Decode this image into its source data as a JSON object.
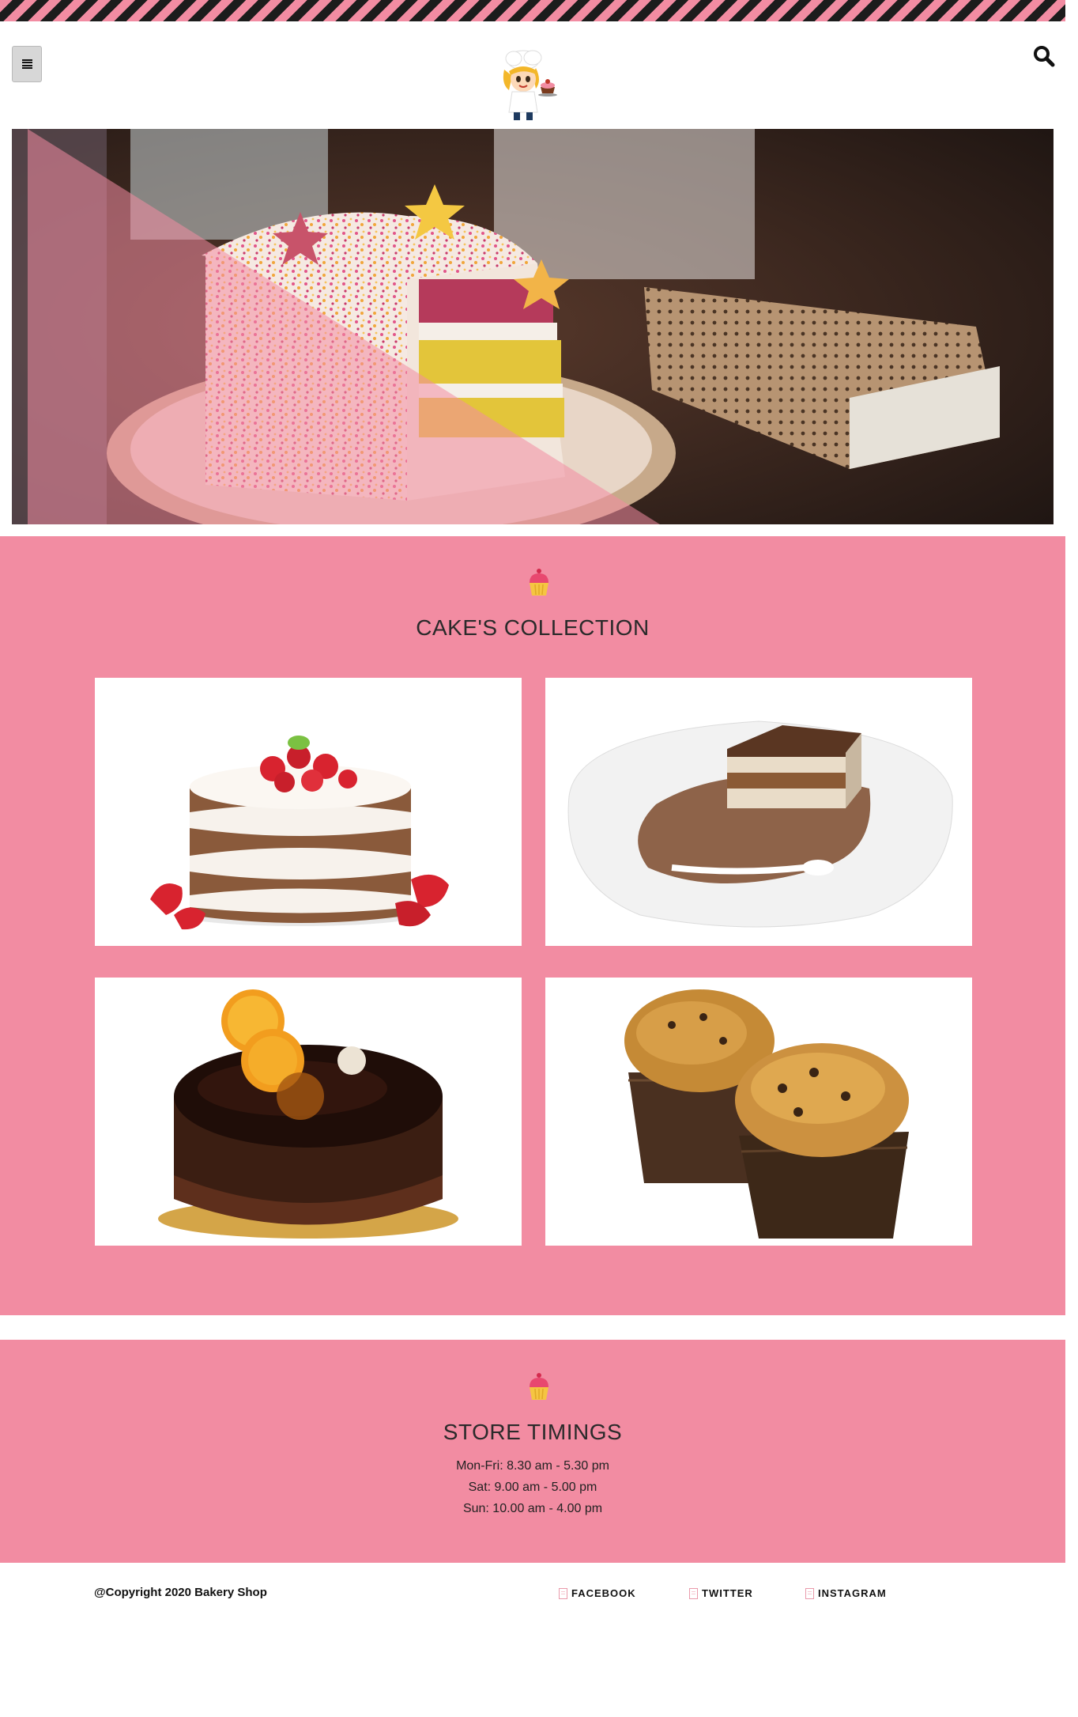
{
  "header": {
    "menu_icon": "hamburger-icon",
    "search_icon": "search-icon",
    "logo_icon": "chef-mascot-logo"
  },
  "collection": {
    "icon": "cupcake-icon",
    "title": "CAKE'S COLLECTION",
    "cards": [
      {
        "image": "strawberry-layer-cake"
      },
      {
        "image": "tiramisu-slice"
      },
      {
        "image": "chocolate-orange-cake"
      },
      {
        "image": "chocolate-chip-muffins"
      }
    ]
  },
  "timings": {
    "icon": "cupcake-icon",
    "title": "STORE TIMINGS",
    "lines": [
      "Mon-Fri: 8.30 am - 5.30 pm",
      "Sat: 9.00 am - 5.00 pm",
      "Sun: 10.00 am - 4.00 pm"
    ]
  },
  "footer": {
    "copyright": "@Copyright 2020 Bakery Shop",
    "social": [
      {
        "label": "FACEBOOK",
        "icon": "broken-image-icon"
      },
      {
        "label": "TWITTER",
        "icon": "broken-image-icon"
      },
      {
        "label": "INSTAGRAM",
        "icon": "broken-image-icon"
      }
    ]
  },
  "colors": {
    "accent_pink": "#f28ca2",
    "stripe_dark": "#1c1c1c",
    "text_dark": "#222222"
  }
}
